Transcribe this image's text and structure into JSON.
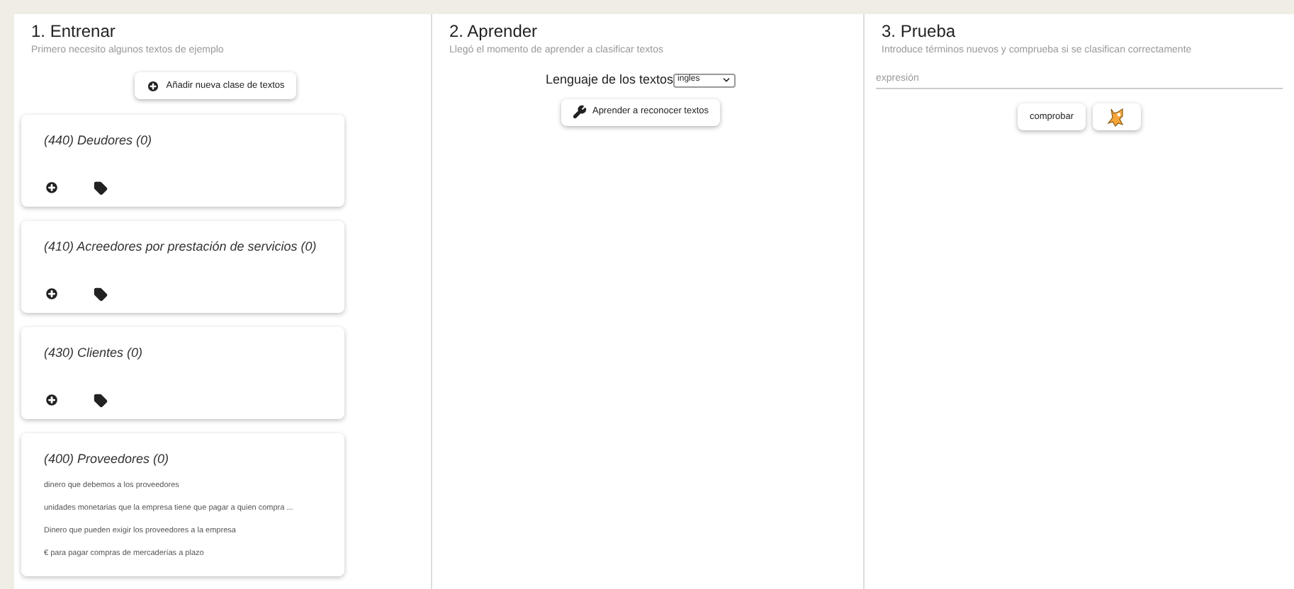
{
  "train": {
    "title": "1. Entrenar",
    "subtitle": "Primero necesito algunos textos de ejemplo",
    "add_button": "Añadir nueva clase de textos",
    "classes": [
      {
        "name": "(440) Deudores (0)"
      },
      {
        "name": "(410) Acreedores por prestación de servicios (0)"
      },
      {
        "name": "(430) Clientes (0)"
      },
      {
        "name": "(400) Proveedores (0)",
        "examples": [
          "dinero que debemos a los proveedores",
          "unidades monetarias que la empresa tiene que pagar a quien compra ...",
          "Dinero que pueden exigir los proveedores a la empresa",
          "€ para pagar compras de mercaderías a plazo"
        ]
      }
    ]
  },
  "learn": {
    "title": "2. Aprender",
    "subtitle": "Llegó el momento de aprender a clasificar textos",
    "language_label": "Lenguaje de los textos",
    "language_value": "ingles",
    "learn_button": "Aprender a reconocer textos"
  },
  "test": {
    "title": "3. Prueba",
    "subtitle": "Introduce términos nuevos y comprueba si se clasifican correctamente",
    "placeholder": "expresión",
    "check_button": "comprobar"
  }
}
